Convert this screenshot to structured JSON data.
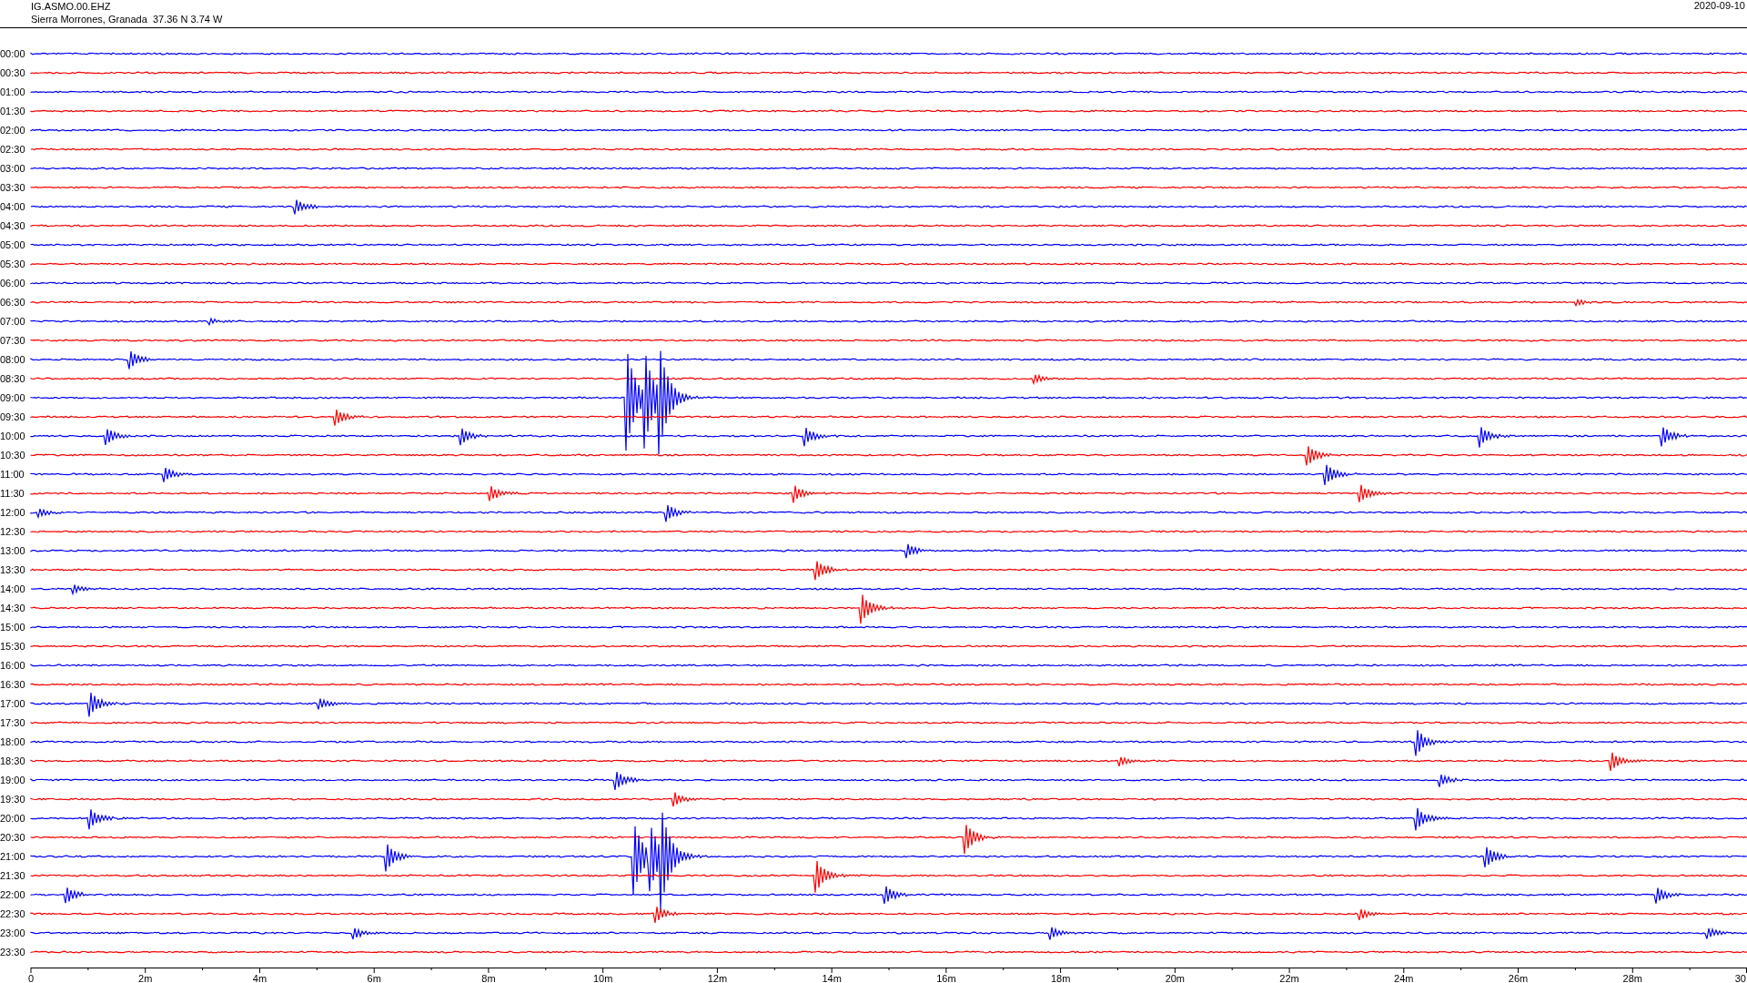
{
  "header": {
    "station": "IG.ASMO.00.EHZ",
    "location": "Sierra Morrones, Granada  37.36 N 3.74 W",
    "date": "2020-09-10"
  },
  "rows": [
    {
      "time": "00:00",
      "color": "#0000ff"
    },
    {
      "time": "00:30",
      "color": "#ff0000"
    },
    {
      "time": "01:00",
      "color": "#0000ff"
    },
    {
      "time": "01:30",
      "color": "#ff0000"
    },
    {
      "time": "02:00",
      "color": "#0000ff"
    },
    {
      "time": "02:30",
      "color": "#ff0000"
    },
    {
      "time": "03:00",
      "color": "#0000ff"
    },
    {
      "time": "03:30",
      "color": "#ff0000"
    },
    {
      "time": "04:00",
      "color": "#0000ff"
    },
    {
      "time": "04:30",
      "color": "#ff0000"
    },
    {
      "time": "05:00",
      "color": "#0000ff"
    },
    {
      "time": "05:30",
      "color": "#ff0000"
    },
    {
      "time": "06:00",
      "color": "#0000ff"
    },
    {
      "time": "06:30",
      "color": "#ff0000"
    },
    {
      "time": "07:00",
      "color": "#0000ff"
    },
    {
      "time": "07:30",
      "color": "#ff0000"
    },
    {
      "time": "08:00",
      "color": "#0000ff"
    },
    {
      "time": "08:30",
      "color": "#ff0000"
    },
    {
      "time": "09:00",
      "color": "#0000ff"
    },
    {
      "time": "09:30",
      "color": "#ff0000"
    },
    {
      "time": "10:00",
      "color": "#0000ff"
    },
    {
      "time": "10:30",
      "color": "#ff0000"
    },
    {
      "time": "11:00",
      "color": "#0000ff"
    },
    {
      "time": "11:30",
      "color": "#ff0000"
    },
    {
      "time": "12:00",
      "color": "#0000ff"
    },
    {
      "time": "12:30",
      "color": "#ff0000"
    },
    {
      "time": "13:00",
      "color": "#0000ff"
    },
    {
      "time": "13:30",
      "color": "#ff0000"
    },
    {
      "time": "14:00",
      "color": "#0000ff"
    },
    {
      "time": "14:30",
      "color": "#ff0000"
    },
    {
      "time": "15:00",
      "color": "#0000ff"
    },
    {
      "time": "15:30",
      "color": "#ff0000"
    },
    {
      "time": "16:00",
      "color": "#0000ff"
    },
    {
      "time": "16:30",
      "color": "#ff0000"
    },
    {
      "time": "17:00",
      "color": "#0000ff"
    },
    {
      "time": "17:30",
      "color": "#ff0000"
    },
    {
      "time": "18:00",
      "color": "#0000ff"
    },
    {
      "time": "18:30",
      "color": "#ff0000"
    },
    {
      "time": "19:00",
      "color": "#0000ff"
    },
    {
      "time": "19:30",
      "color": "#ff0000"
    },
    {
      "time": "20:00",
      "color": "#0000ff"
    },
    {
      "time": "20:30",
      "color": "#ff0000"
    },
    {
      "time": "21:00",
      "color": "#0000ff"
    },
    {
      "time": "21:30",
      "color": "#ff0000"
    },
    {
      "time": "22:00",
      "color": "#0000ff"
    },
    {
      "time": "22:30",
      "color": "#ff0000"
    },
    {
      "time": "23:00",
      "color": "#0000ff"
    },
    {
      "time": "23:30",
      "color": "#ff0000"
    }
  ],
  "x_axis": {
    "ticks": [
      "0",
      "2m",
      "4m",
      "6m",
      "8m",
      "10m",
      "12m",
      "14m",
      "16m",
      "18m",
      "20m",
      "22m",
      "24m",
      "26m",
      "28m",
      "30"
    ]
  }
}
